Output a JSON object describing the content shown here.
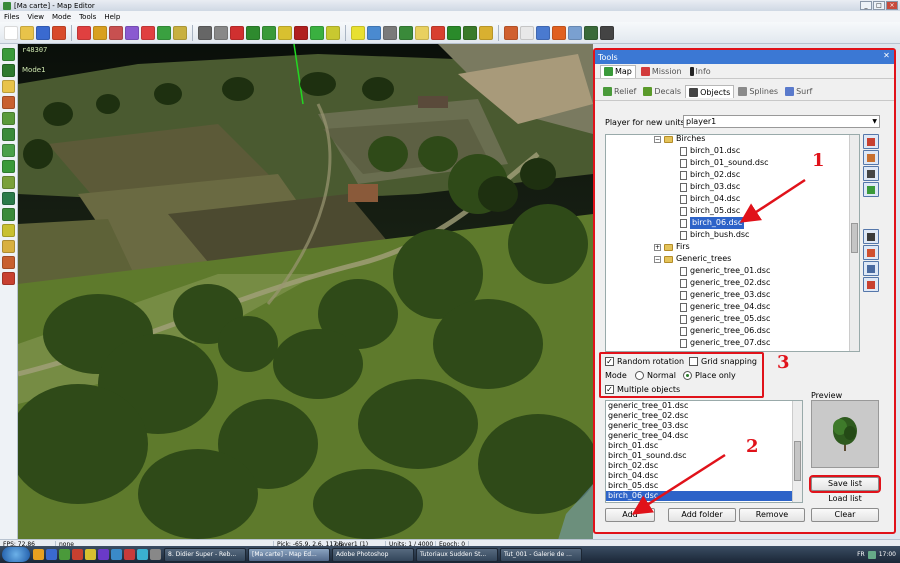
{
  "window": {
    "title": "[Ma carte] - Map Editor"
  },
  "menu": [
    "Files",
    "View",
    "Mode",
    "Tools",
    "Help"
  ],
  "viewport": {
    "coords_text": "r48307",
    "mode_text": "Mode1"
  },
  "tools_panel": {
    "title": "Tools",
    "main_tabs": [
      "Map",
      "Mission",
      "Info"
    ],
    "sub_tabs": [
      "Relief",
      "Decals",
      "Objects",
      "Splines",
      "Surf"
    ],
    "player_label": "Player for new units",
    "player_value": "player1",
    "tree": [
      {
        "label": "Birches",
        "kind": "folder"
      },
      {
        "label": "birch_01.dsc",
        "kind": "file"
      },
      {
        "label": "birch_01_sound.dsc",
        "kind": "file"
      },
      {
        "label": "birch_02.dsc",
        "kind": "file"
      },
      {
        "label": "birch_03.dsc",
        "kind": "file"
      },
      {
        "label": "birch_04.dsc",
        "kind": "file"
      },
      {
        "label": "birch_05.dsc",
        "kind": "file"
      },
      {
        "label": "birch_06.dsc",
        "kind": "file",
        "selected": true
      },
      {
        "label": "birch_bush.dsc",
        "kind": "file"
      },
      {
        "label": "Firs",
        "kind": "folder"
      },
      {
        "label": "Generic_trees",
        "kind": "folder"
      },
      {
        "label": "generic_tree_01.dsc",
        "kind": "file"
      },
      {
        "label": "generic_tree_02.dsc",
        "kind": "file"
      },
      {
        "label": "generic_tree_03.dsc",
        "kind": "file"
      },
      {
        "label": "generic_tree_04.dsc",
        "kind": "file"
      },
      {
        "label": "generic_tree_05.dsc",
        "kind": "file"
      },
      {
        "label": "generic_tree_06.dsc",
        "kind": "file"
      },
      {
        "label": "generic_tree_07.dsc",
        "kind": "file"
      }
    ],
    "options": {
      "random_rotation": "Random rotation",
      "random_rotation_checked": true,
      "grid_snapping": "Grid snapping",
      "grid_snapping_checked": false,
      "mode_label": "Mode",
      "mode_normal": "Normal",
      "mode_place_only": "Place only",
      "mode_selected": "Place only",
      "multiple_objects": "Multiple objects",
      "multiple_objects_checked": true
    },
    "list": [
      "generic_tree_01.dsc",
      "generic_tree_02.dsc",
      "generic_tree_03.dsc",
      "generic_tree_04.dsc",
      "birch_01.dsc",
      "birch_01_sound.dsc",
      "birch_02.dsc",
      "birch_04.dsc",
      "birch_05.dsc",
      "birch_06.dsc"
    ],
    "list_selected": "birch_06.dsc",
    "preview_label": "Preview",
    "buttons": {
      "save_list": "Save list",
      "load_list": "Load list",
      "clear": "Clear",
      "add": "Add",
      "add_folder": "Add folder",
      "remove": "Remove"
    }
  },
  "annotations": [
    "1",
    "2",
    "3"
  ],
  "status": {
    "fps": "FPS: 72.86",
    "selection": "none",
    "pick": "Pick: -65.9, 2.6, 117.6",
    "player": "player1 (1)",
    "units": "Units: 1 / 4000",
    "epoch": "Epoch: 0"
  },
  "taskbar": {
    "tasks": [
      "8. Didier Super - Reb...",
      "[Ma carte] - Map Ed...",
      "Adobe Photoshop",
      "Tutoriaux Sudden St...",
      "Tut_001 - Galerie de ..."
    ],
    "active_task": "[Ma carte] - Map Ed...",
    "lang": "FR",
    "clock": "17:00"
  },
  "colors": {
    "highlight": "#e0121a",
    "selection": "#2d63c8",
    "panel_title": "#3b78d4"
  }
}
